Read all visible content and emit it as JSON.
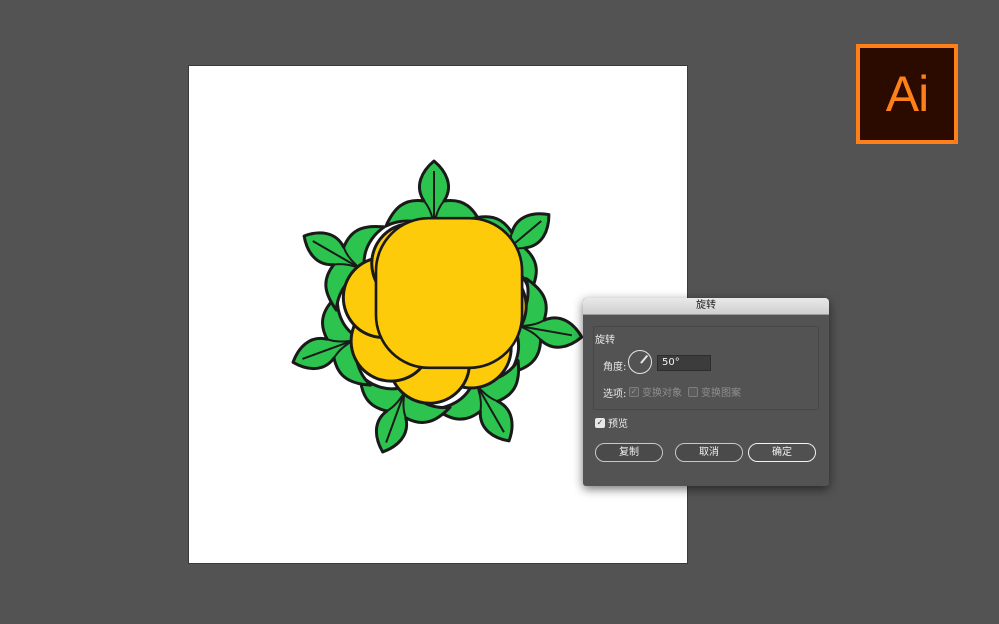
{
  "logo": {
    "text": "Ai"
  },
  "dialog": {
    "title": "旋转",
    "group_label": "旋转",
    "angle_label": "角度:",
    "angle_value": "50°",
    "options_label": "选项:",
    "option_transform_objects": "变换对象",
    "option_transform_patterns": "变换图案",
    "preview_label": "预览",
    "buttons": {
      "copy": "复制",
      "cancel": "取消",
      "ok": "确定"
    }
  },
  "artwork": {
    "description_colors": {
      "petal_fill": "#fecb0b",
      "leaf_fill": "#2cc44e",
      "leaf_fill_light": "#3fd25e",
      "outline": "#1a1a1a"
    }
  },
  "colors": {
    "workspace_bg": "#535353",
    "ai_orange": "#ff7f18",
    "ai_bg": "#2b0a00"
  }
}
